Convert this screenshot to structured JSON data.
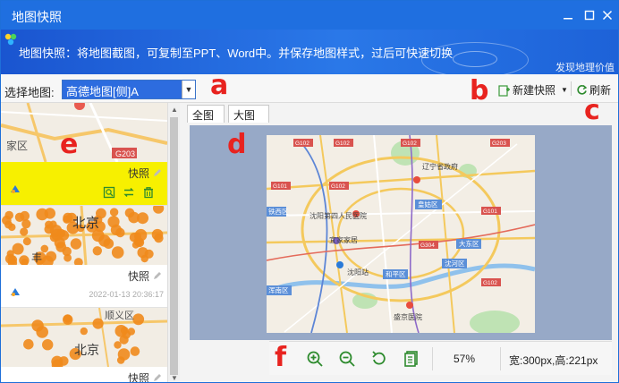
{
  "window": {
    "title": "地图快照"
  },
  "banner": {
    "description": "地图快照：将地图截图，可复制至PPT、Word中。并保存地图样式，过后可快速切换",
    "slogan": "发现地理价值"
  },
  "toolbar": {
    "select_label": "选择地图:",
    "select_value": "高德地图[侧]A",
    "new_snapshot_label": "新建快照",
    "refresh_label": "刷新"
  },
  "markers": {
    "a": "a",
    "b": "b",
    "c": "c",
    "d": "d",
    "e": "e",
    "f": "f"
  },
  "snapshots": [
    {
      "caption": "快照",
      "map_labels": [
        "家区",
        "G203"
      ],
      "selected": true,
      "highlight_color": "#f7f000"
    },
    {
      "caption": "快照",
      "map_labels": [
        "北京",
        "丰"
      ],
      "timestamp": "2022-01-13 20:36:17"
    },
    {
      "caption": "快照",
      "map_labels": [
        "顺义区",
        "北京"
      ]
    }
  ],
  "tabs": [
    {
      "label": "全图",
      "active": true
    },
    {
      "label": "大图",
      "active": false
    }
  ],
  "preview": {
    "labels": {
      "l1": "辽宁省政府",
      "l2": "皇姑区",
      "l3": "沈阳第四人民医院",
      "l4": "宜家家居",
      "l5": "大东区",
      "l6": "铁西区",
      "l7": "沈阳站",
      "l8": "和平区",
      "l9": "沈河区",
      "l10": "浑南区",
      "l11": "盛京医院"
    },
    "road_badges": [
      "G102",
      "G102",
      "G102",
      "G203",
      "G101",
      "G102",
      "G304",
      "G101",
      "G102"
    ]
  },
  "zoombar": {
    "zoom_percent": "57%",
    "size_text": "宽:300px,高:221px"
  },
  "colors": {
    "titlebar": "#1f6fe0",
    "selection": "#2d6cdf",
    "marker_red": "#e8231f",
    "highlight_yellow": "#f7f000",
    "preview_bg": "#97a9c7",
    "dot_orange": "#f08a1c"
  },
  "icons": {
    "window_min": "minimize-icon",
    "window_max": "maximize-icon",
    "window_close": "close-icon",
    "new_snapshot": "add-snapshot-icon",
    "refresh": "refresh-icon",
    "zoom_in": "zoom-in-icon",
    "zoom_out": "zoom-out-icon",
    "undo": "undo-icon",
    "copy": "copy-icon"
  }
}
